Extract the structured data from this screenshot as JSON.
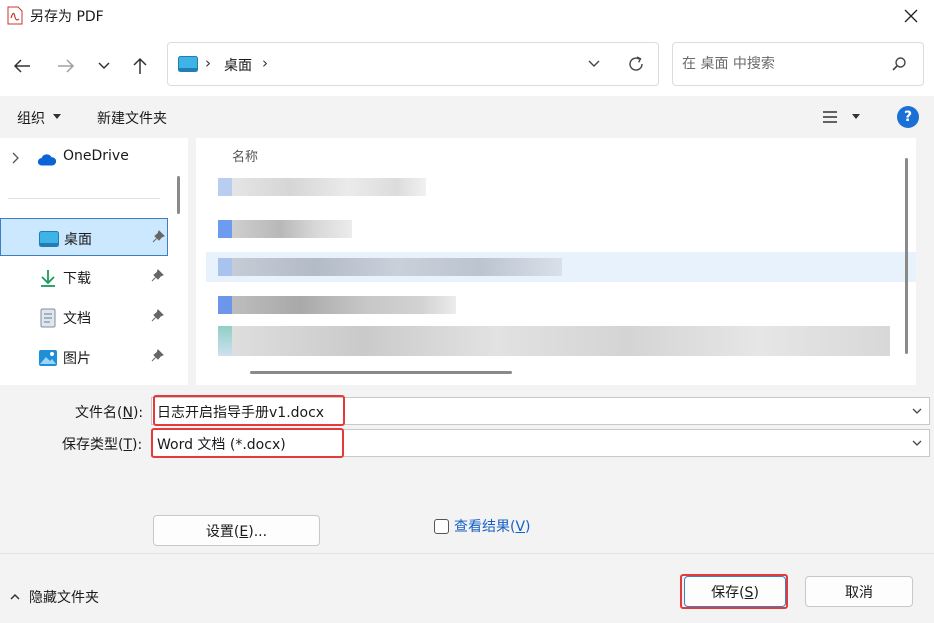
{
  "window": {
    "title": "另存为 PDF",
    "icon": "pdf-file-icon"
  },
  "navigation": {
    "address": {
      "breadcrumb": [
        "桌面"
      ],
      "folder_icon": "desktop-folder-icon"
    },
    "search": {
      "placeholder": "在 桌面 中搜索"
    }
  },
  "toolbar": {
    "organize_label": "组织",
    "new_folder_label": "新建文件夹",
    "help_label": "?"
  },
  "sidebar": {
    "items": [
      {
        "label": "OneDrive",
        "icon": "onedrive-cloud-icon",
        "expandable": true
      },
      {
        "label": "桌面",
        "icon": "desktop-folder-icon",
        "selected": true,
        "pinned": true
      },
      {
        "label": "下载",
        "icon": "download-arrow-icon",
        "pinned": true
      },
      {
        "label": "文档",
        "icon": "document-icon",
        "pinned": true
      },
      {
        "label": "图片",
        "icon": "picture-icon",
        "pinned": true
      }
    ]
  },
  "file_list": {
    "column_header": "名称"
  },
  "form": {
    "filename_label": "文件名(",
    "filename_key": "N",
    "filename_label_end": "):",
    "filename_value": "日志开启指导手册v1.docx",
    "filetype_label": "保存类型(",
    "filetype_key": "T",
    "filetype_label_end": "):",
    "filetype_value": "Word 文档 (*.docx)",
    "settings_label": "设置(",
    "settings_key": "E",
    "settings_label_end": ")...",
    "view_results_label": "查看结果(",
    "view_results_key": "V",
    "view_results_label_end": ")"
  },
  "footer": {
    "hide_folders_label": "隐藏文件夹",
    "save_label": "保存(",
    "save_key": "S",
    "save_label_end": ")",
    "cancel_label": "取消"
  },
  "colors": {
    "accent": "#1b70d6",
    "selection": "#cce8ff",
    "highlight_box": "#e53a3a",
    "link": "#1760c4"
  }
}
